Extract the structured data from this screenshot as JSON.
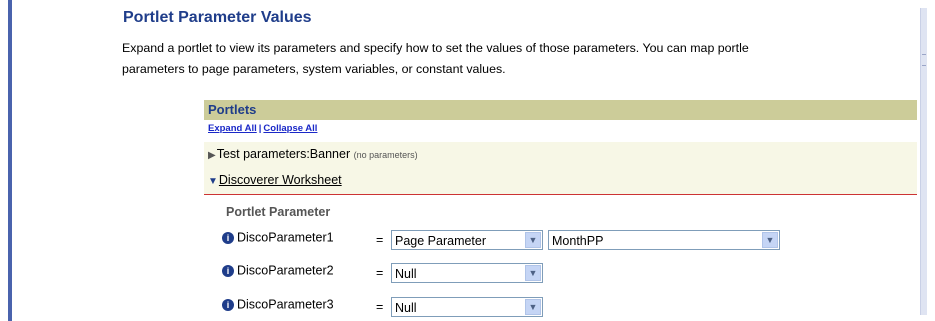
{
  "page": {
    "title": "Portlet Parameter Values",
    "description_line1": "Expand a portlet to view its parameters and specify how to set the values of those parameters. You can map portle",
    "description_line2": "parameters to page parameters, system variables, or constant values."
  },
  "portlets": {
    "header": "Portlets",
    "expand_all": "Expand All",
    "separator": "|",
    "collapse_all": "Collapse All",
    "items": [
      {
        "label": "Test parameters:Banner",
        "note": "(no parameters)",
        "expanded": false
      },
      {
        "label": "Discoverer Worksheet",
        "expanded": true
      }
    ]
  },
  "parameter_section": {
    "heading": "Portlet Parameter",
    "equals": "=",
    "info_icon": "info-icon",
    "rows": [
      {
        "name": "DiscoParameter1",
        "type": "Page Parameter",
        "value": "MonthPP"
      },
      {
        "name": "DiscoParameter2",
        "type": "Null"
      },
      {
        "name": "DiscoParameter3",
        "type": "Null"
      }
    ]
  },
  "colors": {
    "title": "#1f3d8a",
    "header_bg": "#cccc99",
    "row_bg": "#f7f7e6",
    "link": "#1a28c8",
    "left_bar": "#4a63ad"
  }
}
